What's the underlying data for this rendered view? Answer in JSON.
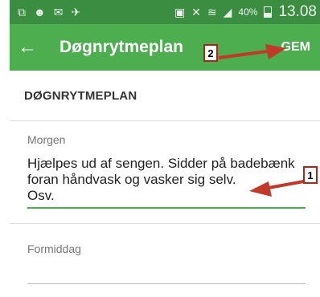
{
  "status_bar": {
    "icons": [
      "screenshot-icon",
      "person-icon",
      "message-icon",
      "bird-icon",
      "nfc-icon",
      "mute-icon",
      "wifi-icon",
      "signal-icon"
    ],
    "battery": "40%",
    "battery_level": 0.4,
    "time": "13.08"
  },
  "app_bar": {
    "back_icon": "arrow-back-icon",
    "title": "Døgnrytmeplan",
    "save_label": "GEM",
    "callout_number": "2"
  },
  "content": {
    "section_title": "DØGNRYTMEPLAN",
    "fields": [
      {
        "label": "Morgen",
        "value": "Hjælpes ud af sengen. Sidder på badebænk\nforan håndvask og vasker sig selv.\nOsv.",
        "callout_number": "1"
      },
      {
        "label": "Formiddag",
        "value": ""
      }
    ]
  },
  "colors": {
    "status_bar": "#3b8d42",
    "app_bar": "#4cae4f",
    "accent": "#4cae4f",
    "annotation": "#c0392b"
  }
}
